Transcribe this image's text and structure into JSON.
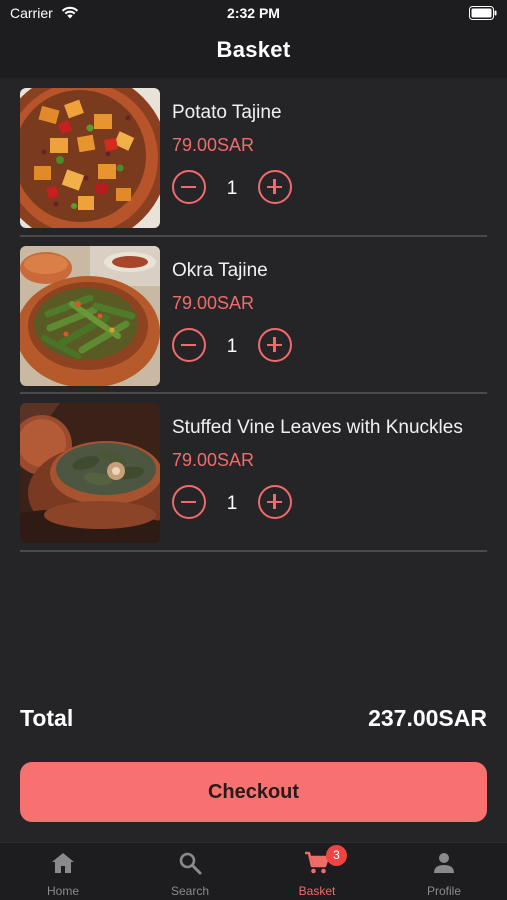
{
  "status_bar": {
    "carrier": "Carrier",
    "time": "2:32 PM"
  },
  "header": {
    "title": "Basket"
  },
  "items": [
    {
      "name": "Potato Tajine",
      "price": "79.00SAR",
      "quantity": "1",
      "image": "potato-tajine-photo"
    },
    {
      "name": "Okra Tajine",
      "price": "79.00SAR",
      "quantity": "1",
      "image": "okra-tajine-photo"
    },
    {
      "name": "Stuffed Vine Leaves with Knuckles",
      "price": "79.00SAR",
      "quantity": "1",
      "image": "stuffed-vine-leaves-photo"
    }
  ],
  "total": {
    "label": "Total",
    "value": "237.00SAR"
  },
  "checkout": {
    "label": "Checkout"
  },
  "tabbar": {
    "tabs": [
      {
        "label": "Home",
        "icon": "home-icon"
      },
      {
        "label": "Search",
        "icon": "search-icon"
      },
      {
        "label": "Basket",
        "icon": "cart-icon",
        "badge": "3",
        "active": true
      },
      {
        "label": "Profile",
        "icon": "person-icon"
      }
    ]
  },
  "colors": {
    "accent": "#f26b6b",
    "background": "#252528",
    "bar": "#1d1d20",
    "badge": "#ef4444"
  }
}
